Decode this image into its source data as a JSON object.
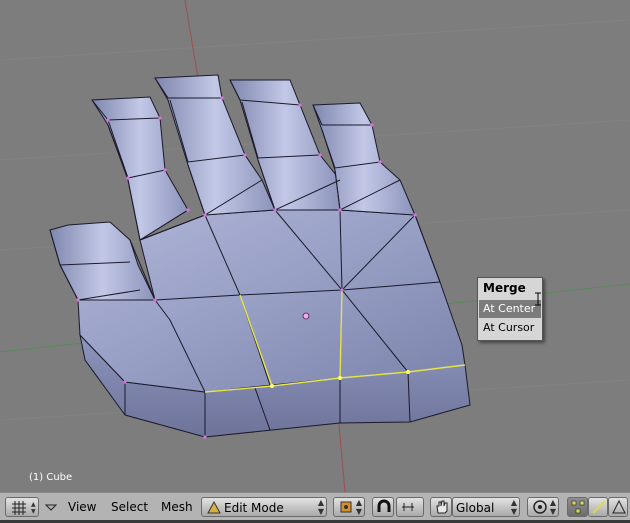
{
  "viewport": {
    "object_label": "(1) Cube",
    "background_color": "#7d7d7d",
    "mesh_color": "#9aa1c6",
    "edge_color": "#1a1a2a",
    "selected_edge_color": "#e6e64a"
  },
  "popup": {
    "title": "Merge",
    "items": [
      "At Center",
      "At Cursor"
    ],
    "highlighted": "At Center"
  },
  "header": {
    "menus": [
      "View",
      "Select",
      "Mesh"
    ],
    "mode": "Edit Mode",
    "orientation": "Global",
    "icons": [
      "editor-type-icon",
      "collapse-arrow-icon",
      "mode-icon",
      "pivot-icon",
      "snap-magnet-icon",
      "snap-type-icon",
      "manipulator-hand-icon",
      "proportional-edit-icon",
      "vertex-select-icon",
      "edge-select-icon",
      "face-select-icon"
    ]
  }
}
